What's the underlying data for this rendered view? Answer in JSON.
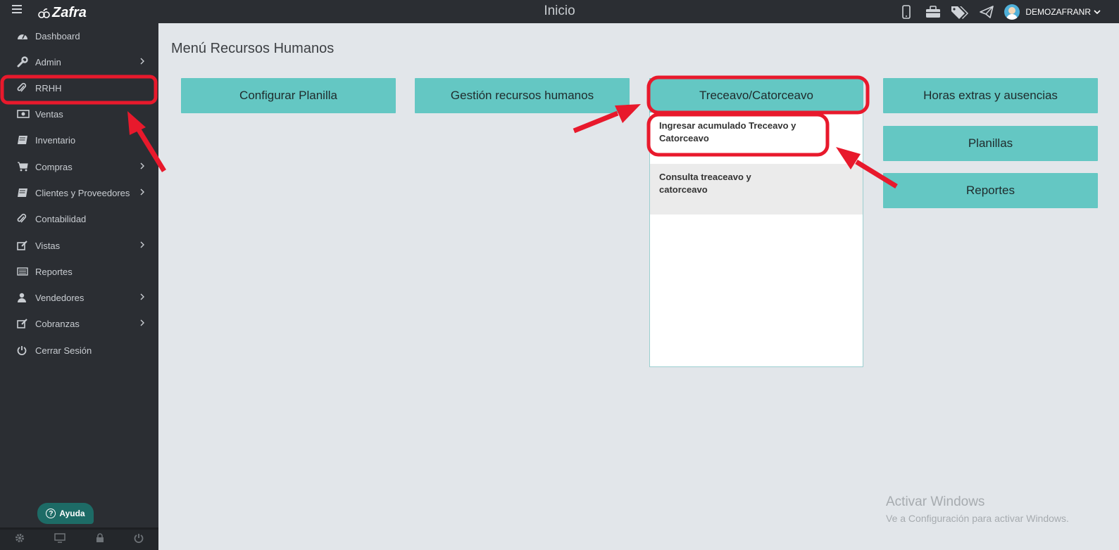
{
  "app": {
    "logo_text": "Zafra",
    "page_title": "Inicio"
  },
  "topbar": {
    "icons": [
      "mobile-icon",
      "briefcase-icon",
      "tags-icon",
      "paper-plane-icon"
    ],
    "user_name": "DEMOZAFRANR"
  },
  "sidebar": {
    "items": [
      {
        "label": "Dashboard",
        "icon": "dashboard-icon",
        "has_submenu": false
      },
      {
        "label": "Admin",
        "icon": "wrench-icon",
        "has_submenu": true
      },
      {
        "label": "RRHH",
        "icon": "paperclip-icon",
        "has_submenu": false
      },
      {
        "label": "Ventas",
        "icon": "money-icon",
        "has_submenu": false
      },
      {
        "label": "Inventario",
        "icon": "book-icon",
        "has_submenu": false
      },
      {
        "label": "Compras",
        "icon": "cart-icon",
        "has_submenu": true
      },
      {
        "label": "Clientes y Proveedores",
        "icon": "book-icon",
        "has_submenu": true
      },
      {
        "label": "Contabilidad",
        "icon": "paperclip-icon",
        "has_submenu": false
      },
      {
        "label": "Vistas",
        "icon": "edit-icon",
        "has_submenu": true
      },
      {
        "label": "Reportes",
        "icon": "list-icon",
        "has_submenu": false
      },
      {
        "label": "Vendedores",
        "icon": "user-icon",
        "has_submenu": true
      },
      {
        "label": "Cobranzas",
        "icon": "edit-icon",
        "has_submenu": true
      },
      {
        "label": "Cerrar Sesión",
        "icon": "power-icon",
        "has_submenu": false
      }
    ],
    "help_label": "Ayuda",
    "footer_icons": [
      "gear-icon",
      "monitor-icon",
      "lock-icon",
      "power-icon"
    ]
  },
  "main": {
    "title": "Menú Recursos Humanos",
    "tiles": {
      "configurar_planilla": "Configurar Planilla",
      "gestion_rrhh": "Gestión recursos humanos",
      "treceavo": "Treceavo/Catorceavo",
      "horas_extras": "Horas extras y ausencias",
      "planillas": "Planillas",
      "reportes": "Reportes"
    },
    "dropdown": {
      "item1_line1": "Ingresar acumulado Treceavo y",
      "item1_line2": "Catorceavo",
      "item2_line1": "Consulta treaceavo y",
      "item2_line2": "catorceavo"
    }
  },
  "watermark": {
    "line1": "Activar Windows",
    "line2": "Ve a Configuración para activar Windows."
  },
  "colors": {
    "sidebar_bg": "#2b2e33",
    "tile_bg": "#64c7c3",
    "content_bg": "#e2e6ea",
    "annotation": "#e8192c"
  }
}
